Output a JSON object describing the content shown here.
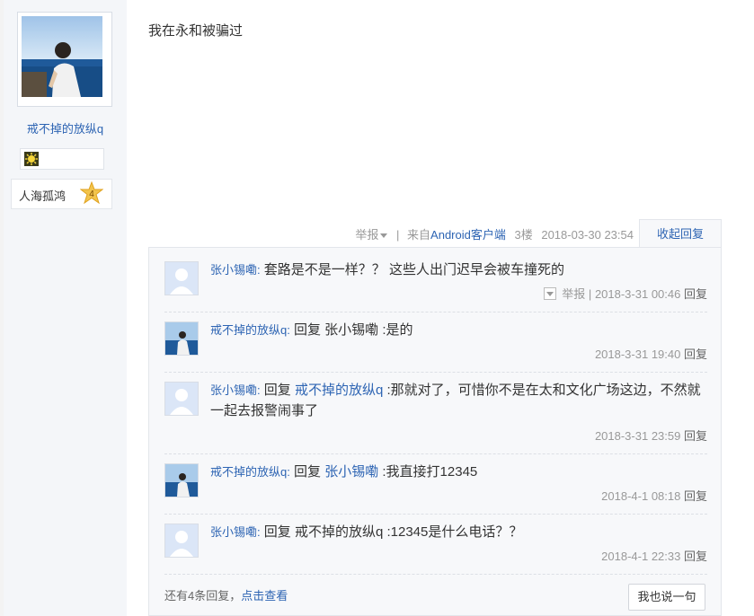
{
  "author": {
    "username": "戒不掉的放纵q",
    "level_name": "人海孤鸿",
    "level_number": "4"
  },
  "post": {
    "content": "我在永和被骗过"
  },
  "tail": {
    "report_label": "举报",
    "separator": "|",
    "source_prefix": "来自",
    "source_link": "Android客户端",
    "floor": "3楼",
    "datetime": "2018-03-30 23:54",
    "collapse_label": "收起回复"
  },
  "replies": [
    {
      "user": "张小锡嘞:",
      "reply_word": "",
      "target": "",
      "text": " 套路是不是一样？？ 这些人出门迟早会被车撞死的",
      "report_label": "举报",
      "separator": "|",
      "time": "2018-3-31 00:46",
      "reply_label": "回复"
    },
    {
      "user": "戒不掉的放纵q:",
      "reply_word": " 回复 张小锡嘞",
      "target": "",
      "text": " :是的",
      "time": "2018-3-31 19:40",
      "reply_label": "回复"
    },
    {
      "user": "张小锡嘞:",
      "reply_word": " 回复 ",
      "target": "戒不掉的放纵q",
      "text": " :那就对了，可惜你不是在太和文化广场这边，不然就一起去报警闹事了",
      "time": "2018-3-31 23:59",
      "reply_label": "回复"
    },
    {
      "user": "戒不掉的放纵q:",
      "reply_word": " 回复 ",
      "target": "张小锡嘞",
      "text": " :我直接打12345",
      "time": "2018-4-1 08:18",
      "reply_label": "回复"
    },
    {
      "user": "张小锡嘞:",
      "reply_word": " 回复 戒不掉的放纵q",
      "target": "",
      "text": " :12345是什么电话？？",
      "time": "2018-4-1 22:33",
      "reply_label": "回复"
    }
  ],
  "footer": {
    "more_text": "还有4条回复，",
    "more_link": "点击查看",
    "say_button": "我也说一句"
  },
  "colors": {
    "link": "#2d64b3",
    "sidebar_bg": "#f4f6f9",
    "panel_bg": "#f7f8fa",
    "meta_gray": "#999999"
  },
  "icons": {
    "badge": "sun-badge-icon",
    "level": "star-level-icon",
    "report_dropdown": "dropdown-icon",
    "default_avatar": "default-user-avatar-icon"
  }
}
